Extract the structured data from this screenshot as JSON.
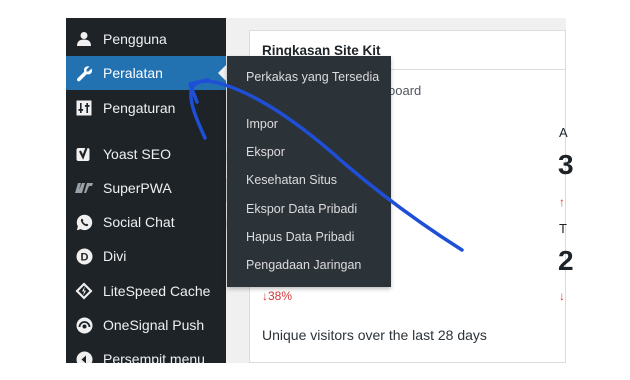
{
  "sidebar": {
    "items": [
      {
        "label": "Pengguna",
        "icon": "user-icon",
        "active": false
      },
      {
        "label": "Peralatan",
        "icon": "wrench-icon",
        "active": true
      },
      {
        "label": "Pengaturan",
        "icon": "settings-sliders-icon",
        "active": false
      },
      {
        "label": "Yoast SEO",
        "icon": "yoast-icon",
        "active": false
      },
      {
        "label": "SuperPWA",
        "icon": "superpwa-icon",
        "active": false
      },
      {
        "label": "Social Chat",
        "icon": "whatsapp-icon",
        "active": false
      },
      {
        "label": "Divi",
        "icon": "divi-icon",
        "active": false
      },
      {
        "label": "LiteSpeed Cache",
        "icon": "litespeed-icon",
        "active": false
      },
      {
        "label": "OneSignal Push",
        "icon": "onesignal-icon",
        "active": false
      },
      {
        "label": "Persempit menu",
        "icon": "collapse-icon",
        "active": false
      }
    ]
  },
  "flyout": {
    "items": [
      "Perkakas yang Tersedia",
      "Impor",
      "Ekspor",
      "Kesehatan Situs",
      "Ekspor Data Pribadi",
      "Hapus Data Pribadi",
      "Pengadaan Jaringan"
    ]
  },
  "card": {
    "title": "Ringkasan Site Kit",
    "link_fragment": "board",
    "right_fragments": [
      "A",
      "3",
      "↑",
      "T",
      "2",
      "↓"
    ],
    "delta": "↓38%",
    "visitors_text": "Unique visitors over the last 28 days"
  },
  "colors": {
    "sidebar_bg": "#1d2327",
    "active_bg": "#2271b1",
    "flyout_bg": "#2c3338",
    "annotation_arrow": "#1f4fd6",
    "delta_red": "#d63638"
  }
}
